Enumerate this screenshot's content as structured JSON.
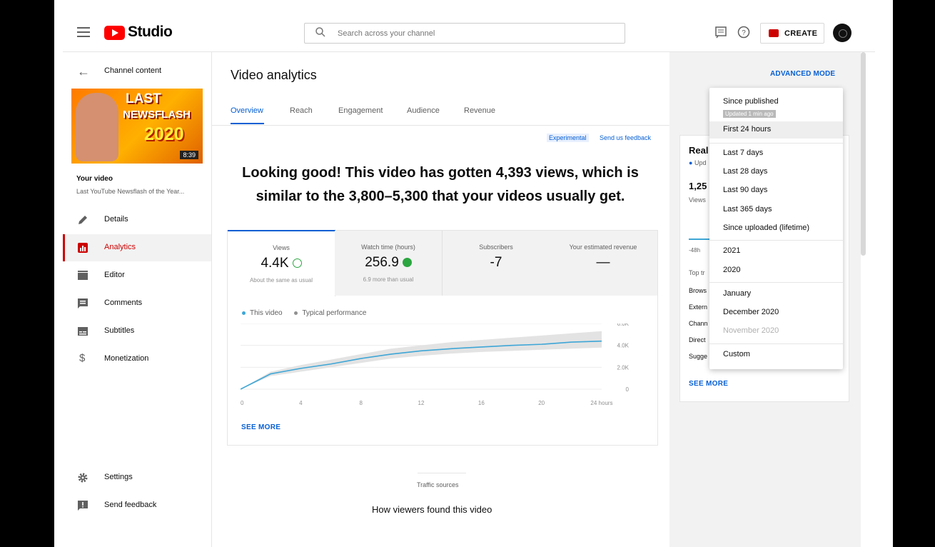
{
  "header": {
    "logo_text": "Studio",
    "search_placeholder": "Search across your channel",
    "create_label": "CREATE"
  },
  "sidebar": {
    "back_label": "Channel content",
    "thumbnail": {
      "line1": "LAST",
      "line2": "NEWSFLASH",
      "line3": "2020",
      "duration": "8:39"
    },
    "your_video_label": "Your video",
    "video_title": "Last YouTube Newsflash of the Year...",
    "nav": [
      {
        "label": "Details",
        "icon": "pencil-icon"
      },
      {
        "label": "Analytics",
        "icon": "analytics-icon",
        "active": true
      },
      {
        "label": "Editor",
        "icon": "clapperboard-icon"
      },
      {
        "label": "Comments",
        "icon": "comments-icon"
      },
      {
        "label": "Subtitles",
        "icon": "subtitles-icon"
      },
      {
        "label": "Monetization",
        "icon": "dollar-icon"
      }
    ],
    "bottom": [
      {
        "label": "Settings",
        "icon": "gear-icon"
      },
      {
        "label": "Send feedback",
        "icon": "feedback-icon"
      }
    ]
  },
  "main": {
    "title": "Video analytics",
    "tabs": [
      "Overview",
      "Reach",
      "Engagement",
      "Audience",
      "Revenue"
    ],
    "experimental": "Experimental",
    "send_feedback": "Send us feedback",
    "headline_1": "Looking good! This video has gotten 4,393 views, which is",
    "headline_2": "similar to the 3,800–5,300 that your videos usually get.",
    "metrics": [
      {
        "label": "Views",
        "value": "4.4K",
        "sub": "About the same as usual"
      },
      {
        "label": "Watch time (hours)",
        "value": "256.9",
        "sub": "6.9 more than usual"
      },
      {
        "label": "Subscribers",
        "value": "-7",
        "sub": ""
      },
      {
        "label": "Your estimated revenue",
        "value": "—",
        "sub": ""
      }
    ],
    "legend": {
      "this_video": "This video",
      "typical": "Typical performance"
    },
    "see_more": "SEE MORE",
    "traffic_label": "Traffic sources",
    "traffic_title": "How viewers found this video"
  },
  "chart_data": {
    "type": "area",
    "x": [
      0,
      2,
      4,
      6,
      8,
      10,
      12,
      14,
      16,
      18,
      20,
      22,
      24
    ],
    "x_tick_labels": [
      "0",
      "4",
      "8",
      "12",
      "16",
      "20",
      "24 hours"
    ],
    "y_tick_labels": [
      "0",
      "2.0K",
      "4.0K",
      "6.0K"
    ],
    "ylim": [
      0,
      6000
    ],
    "series": [
      {
        "name": "This video",
        "values": [
          0,
          1400,
          1900,
          2300,
          2800,
          3200,
          3500,
          3700,
          3850,
          4000,
          4100,
          4300,
          4393
        ]
      },
      {
        "name": "Typical performance",
        "lower": [
          0,
          1200,
          1600,
          2000,
          2400,
          2800,
          3050,
          3250,
          3400,
          3500,
          3600,
          3700,
          3800
        ],
        "upper": [
          0,
          1600,
          2200,
          2700,
          3200,
          3700,
          4000,
          4300,
          4500,
          4700,
          4900,
          5100,
          5300
        ]
      }
    ],
    "colors": {
      "line": "#3ea6d6",
      "band": "#e3e3e3"
    }
  },
  "right": {
    "advanced_mode": "ADVANCED MODE",
    "realtime_title": "Real",
    "realtime_updating": "Upd",
    "realtime_value": "1,25",
    "realtime_views": "Views",
    "realtime_axis": "-48h",
    "top_label": "Top tr",
    "sources": [
      "Brows",
      "Extern",
      "Chann",
      "Direct",
      "Sugge"
    ],
    "see_more": "SEE MORE"
  },
  "dropdown": {
    "since_published": "Since published",
    "updated": "Updated 1 min ago",
    "items_a": [
      "First 24 hours"
    ],
    "items_b": [
      "Last 7 days",
      "Last 28 days",
      "Last 90 days",
      "Last 365 days",
      "Since uploaded (lifetime)"
    ],
    "items_c": [
      "2021",
      "2020"
    ],
    "items_d": [
      "January",
      "December 2020",
      "November 2020"
    ],
    "items_e": [
      "Custom"
    ]
  }
}
